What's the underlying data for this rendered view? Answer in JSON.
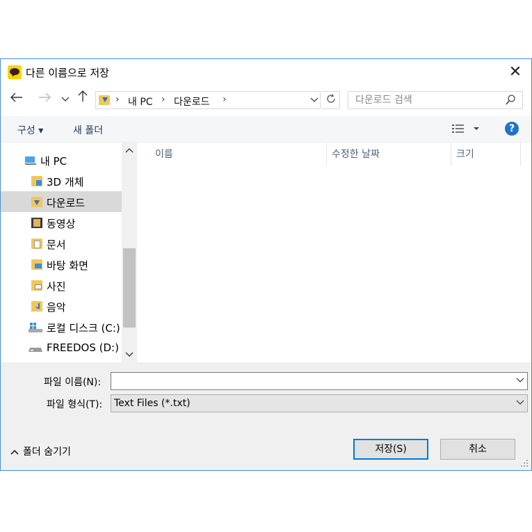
{
  "dialog": {
    "title": "다른 이름으로 저장",
    "close_glyph": "✕"
  },
  "address": {
    "crumbs": [
      "내 PC",
      "다운로드"
    ],
    "separator": "›",
    "search_placeholder": "다운로드 검색"
  },
  "toolbar": {
    "organize_label": "구성 ▾",
    "new_folder_label": "새 폴더",
    "help_label": "?"
  },
  "nav": {
    "items": [
      {
        "label": "내 PC",
        "icon": "pc-icon"
      },
      {
        "label": "3D 개체",
        "icon": "3d-objects-icon"
      },
      {
        "label": "다운로드",
        "icon": "downloads-icon",
        "selected": true
      },
      {
        "label": "동영상",
        "icon": "videos-icon"
      },
      {
        "label": "문서",
        "icon": "documents-icon"
      },
      {
        "label": "바탕 화면",
        "icon": "desktop-icon"
      },
      {
        "label": "사진",
        "icon": "pictures-icon"
      },
      {
        "label": "음악",
        "icon": "music-icon"
      },
      {
        "label": "로컬 디스크 (C:)",
        "icon": "local-disk-icon"
      },
      {
        "label": "FREEDOS (D:)",
        "icon": "drive-icon"
      }
    ]
  },
  "filelist": {
    "columns": [
      "이름",
      "수정한 날짜",
      "크기"
    ]
  },
  "form": {
    "filename_label": "파일 이름(N):",
    "filename_value": "",
    "filetype_label": "파일 형식(T):",
    "filetype_value": "Text Files (*.txt)"
  },
  "footer": {
    "hide_folders_label": "폴더 숨기기",
    "save_label": "저장(S)",
    "cancel_label": "취소"
  },
  "colors": {
    "accent": "#0078d7",
    "border": "#4b8fcf",
    "folder": "#f0c75a",
    "help": "#1e74c8"
  }
}
